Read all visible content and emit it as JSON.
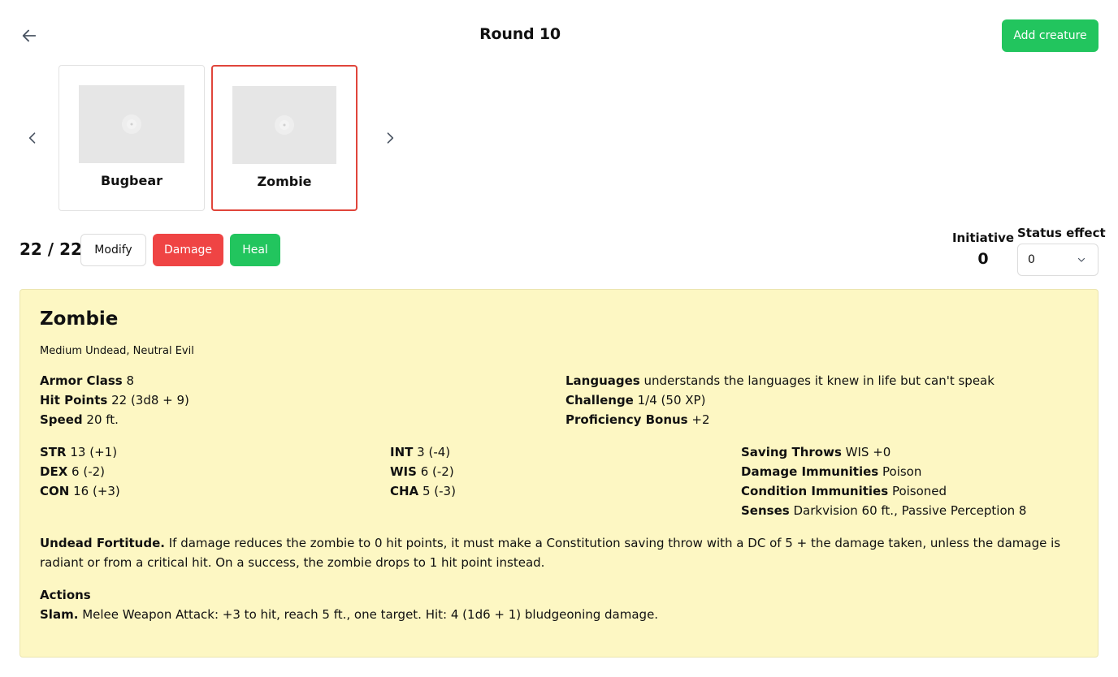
{
  "header": {
    "title": "Round 10",
    "add_button": "Add creature"
  },
  "creatures": [
    {
      "name": "Bugbear",
      "selected": false
    },
    {
      "name": "Zombie",
      "selected": true
    }
  ],
  "hp": {
    "display": "22 / 22"
  },
  "actions": {
    "modify": "Modify",
    "damage": "Damage",
    "heal": "Heal"
  },
  "initiative": {
    "label": "Initiative",
    "value": "0"
  },
  "status_effect": {
    "label": "Status effect",
    "value": "0"
  },
  "statblock": {
    "name": "Zombie",
    "type": "Medium Undead, Neutral Evil",
    "armor_class": {
      "label": "Armor Class",
      "value": "8"
    },
    "hit_points": {
      "label": "Hit Points",
      "value": "22 (3d8 + 9)"
    },
    "speed": {
      "label": "Speed",
      "value": "20 ft."
    },
    "languages": {
      "label": "Languages",
      "value": "understands the languages it knew in life but can't speak"
    },
    "challenge": {
      "label": "Challenge",
      "value": "1/4 (50 XP)"
    },
    "proficiency": {
      "label": "Proficiency Bonus",
      "value": "+2"
    },
    "abilities": [
      {
        "label": "STR",
        "value": "13 (+1)"
      },
      {
        "label": "DEX",
        "value": "6 (-2)"
      },
      {
        "label": "CON",
        "value": "16 (+3)"
      },
      {
        "label": "INT",
        "value": "3 (-4)"
      },
      {
        "label": "WIS",
        "value": "6 (-2)"
      },
      {
        "label": "CHA",
        "value": "5 (-3)"
      }
    ],
    "saving_throws": {
      "label": "Saving Throws",
      "value": "WIS +0"
    },
    "damage_immunities": {
      "label": "Damage Immunities",
      "value": "Poison"
    },
    "condition_immunities": {
      "label": "Condition Immunities",
      "value": "Poisoned"
    },
    "senses": {
      "label": "Senses",
      "value": "Darkvision 60 ft., Passive Perception 8"
    },
    "trait": {
      "name": "Undead Fortitude.",
      "text": "If damage reduces the zombie to 0 hit points, it must make a Constitution saving throw with a DC of 5 + the damage taken, unless the damage is radiant or from a critical hit. On a success, the zombie drops to 1 hit point instead."
    },
    "actions_heading": "Actions",
    "action": {
      "name": "Slam.",
      "text": "Melee Weapon Attack: +3 to hit, reach 5 ft., one target. Hit: 4 (1d6 + 1) bludgeoning damage."
    }
  }
}
